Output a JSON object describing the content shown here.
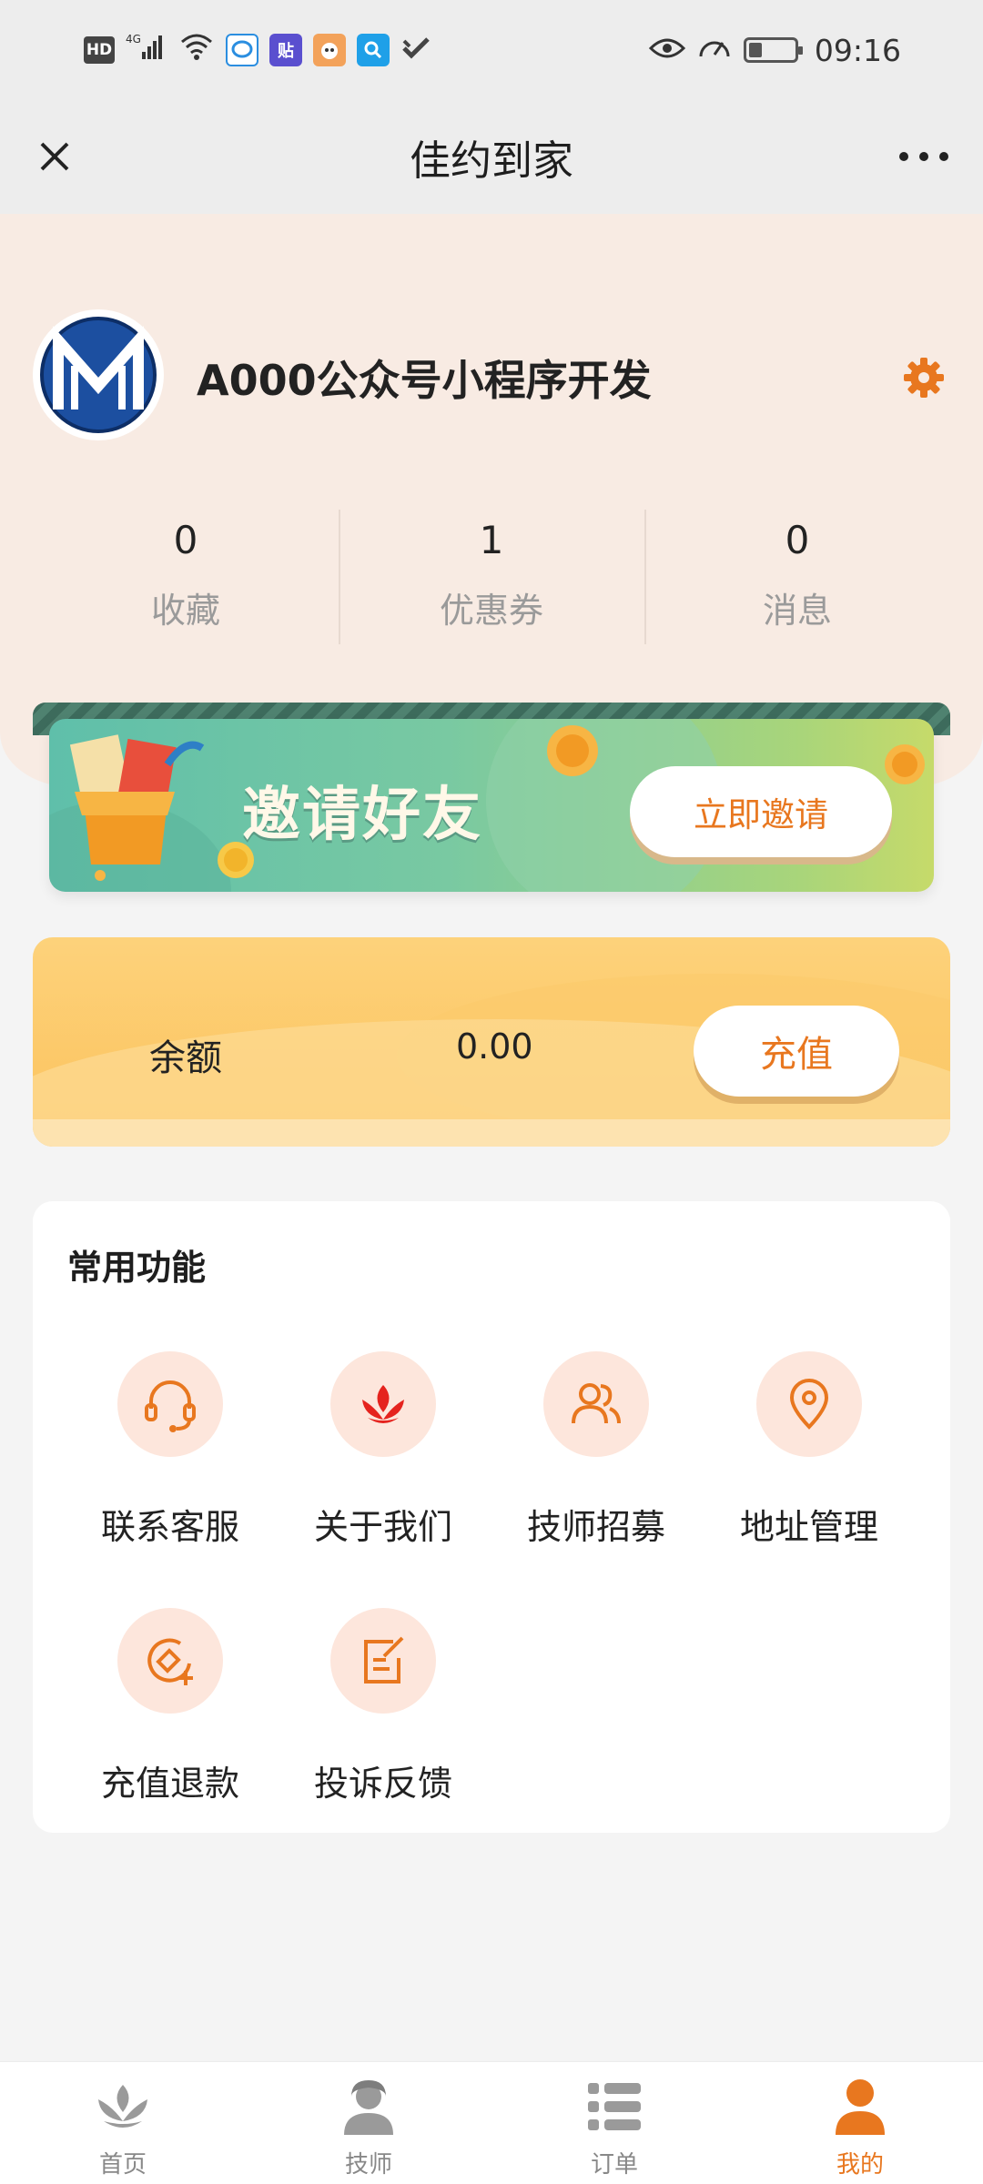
{
  "status_bar": {
    "time": "09:16",
    "left_icons": [
      "hd-icon",
      "signal-4g-icon",
      "wifi-icon",
      "message-app-icon",
      "tieba-app-icon",
      "cartoon-app-icon",
      "search-app-icon",
      "check-app-icon"
    ],
    "right_icons": [
      "eye-icon",
      "speed-icon",
      "battery-icon"
    ]
  },
  "nav": {
    "title": "佳约到家"
  },
  "profile": {
    "username": "A000公众号小程序开发",
    "stats": [
      {
        "value": "0",
        "label": "收藏"
      },
      {
        "value": "1",
        "label": "优惠券"
      },
      {
        "value": "0",
        "label": "消息"
      }
    ]
  },
  "invite": {
    "title": "邀请好友",
    "button": "立即邀请"
  },
  "balance": {
    "label": "余额",
    "value": "0.00",
    "button": "充值"
  },
  "functions": {
    "title": "常用功能",
    "items": [
      {
        "label": "联系客服",
        "icon": "headset-icon"
      },
      {
        "label": "关于我们",
        "icon": "lotus-icon"
      },
      {
        "label": "技师招募",
        "icon": "users-icon"
      },
      {
        "label": "地址管理",
        "icon": "location-pin-icon"
      },
      {
        "label": "充值退款",
        "icon": "recharge-refund-icon"
      },
      {
        "label": "投诉反馈",
        "icon": "edit-note-icon"
      }
    ]
  },
  "tabbar": {
    "items": [
      {
        "label": "首页",
        "icon": "lotus-icon",
        "active": false
      },
      {
        "label": "技师",
        "icon": "technician-icon",
        "active": false
      },
      {
        "label": "订单",
        "icon": "list-icon",
        "active": false
      },
      {
        "label": "我的",
        "icon": "user-icon",
        "active": true
      }
    ]
  },
  "colors": {
    "accent": "#e8771f",
    "accent_light": "#fde6dc",
    "profile_bg": "#f8ebe3",
    "balance_bg": "#fcc25c",
    "invite_bg": "#79c9a2"
  }
}
